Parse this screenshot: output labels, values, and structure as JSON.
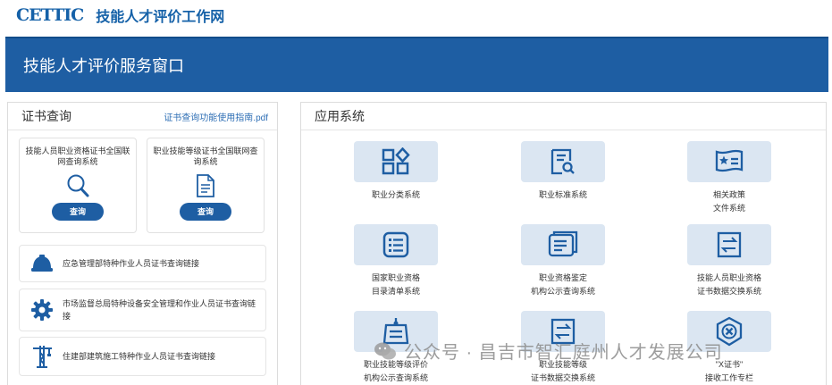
{
  "header": {
    "logo": "CETTIC",
    "site_title": "技能人才评价工作网"
  },
  "banner": {
    "title": "技能人才评价服务窗口"
  },
  "cert_panel": {
    "title": "证书查询",
    "guide_link": "证书查询功能使用指南.pdf",
    "cards": [
      {
        "title": "技能人员职业资格证书全国联网查询系统",
        "button": "查询",
        "icon": "magnifier-icon"
      },
      {
        "title": "职业技能等级证书全国联网查询系统",
        "button": "查询",
        "icon": "document-icon"
      }
    ],
    "links": [
      {
        "text": "应急管理部特种作业人员证书查询链接",
        "icon": "hardhat-icon"
      },
      {
        "text": "市场监督总局特种设备安全管理和作业人员证书查询链接",
        "icon": "gear-icon"
      },
      {
        "text": "住建部建筑施工特种作业人员证书查询链接",
        "icon": "crane-icon"
      }
    ]
  },
  "apps_panel": {
    "title": "应用系统",
    "apps": [
      {
        "label": "职业分类系统",
        "icon": "shapes-icon"
      },
      {
        "label": "职业标准系统",
        "icon": "doc-search-icon"
      },
      {
        "label": "相关政策\n文件系统",
        "icon": "star-book-icon"
      },
      {
        "label": "国家职业资格\n目录清单系统",
        "icon": "list-icon"
      },
      {
        "label": "职业资格鉴定\n机构公示查询系统",
        "icon": "doc-stack-icon"
      },
      {
        "label": "技能人员职业资格\n证书数据交换系统",
        "icon": "exchange-icon"
      },
      {
        "label": "职业技能等级评价\n机构公示查询系统",
        "icon": "badge-icon"
      },
      {
        "label": "职业技能等级\n证书数据交换系统",
        "icon": "exchange-doc-icon"
      },
      {
        "label": "\"X证书\"\n接收工作专栏",
        "icon": "shield-x-icon"
      }
    ]
  },
  "watermark": {
    "text": "公众号 · 昌吉市智汇庭州人才发展公司"
  },
  "colors": {
    "brand": "#1e5ea3",
    "tile_bg": "#dbe6f2",
    "icon": "#1e5ea3"
  }
}
